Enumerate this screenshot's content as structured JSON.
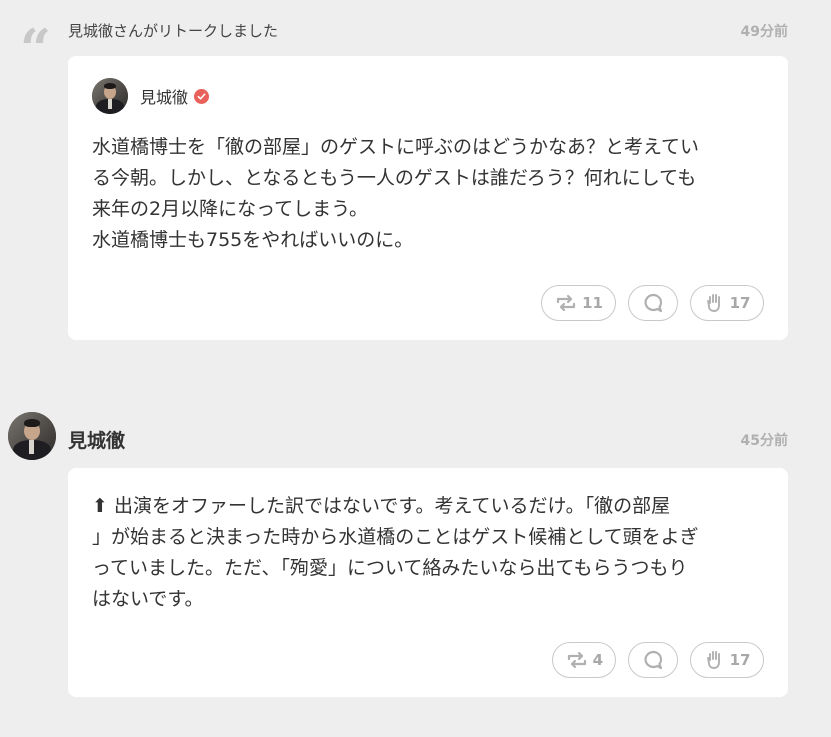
{
  "retalk": {
    "label": "見城徹さんがリトークしました",
    "time": "49分前",
    "author": "見城徹",
    "lines": [
      "水道橋博士を「徹の部屋」のゲストに呼ぶのはどうかなあ？と考えてい",
      "る今朝。しかし、となるともう一人のゲストは誰だろう？何れにしても",
      "来年の2月以降になってしまう。",
      "水道橋博士も755をやればいいのに。"
    ],
    "retalk_count": "11",
    "like_count": "17"
  },
  "post": {
    "author": "見城徹",
    "time": "45分前",
    "arrow": "⬆",
    "lines": [
      "出演をオファーした訳ではないです。考えているだけ。「徹の部屋",
      "」が始まると決まった時から水道橋のことはゲスト候補として頭をよぎ",
      "っていました。ただ、「殉愛」について絡みたいなら出てもらうつもり",
      "はないです。"
    ],
    "retalk_count": "4",
    "like_count": "17"
  },
  "icons": {
    "quote": "quote-icon",
    "verified": "verified-badge-icon",
    "retalk": "retalk-icon",
    "reply": "reply-bubble-icon",
    "like": "like-hand-icon"
  },
  "colors": {
    "background": "#eeeeee",
    "card": "#ffffff",
    "verified": "#e8615a",
    "muted": "#a8a8a8"
  }
}
